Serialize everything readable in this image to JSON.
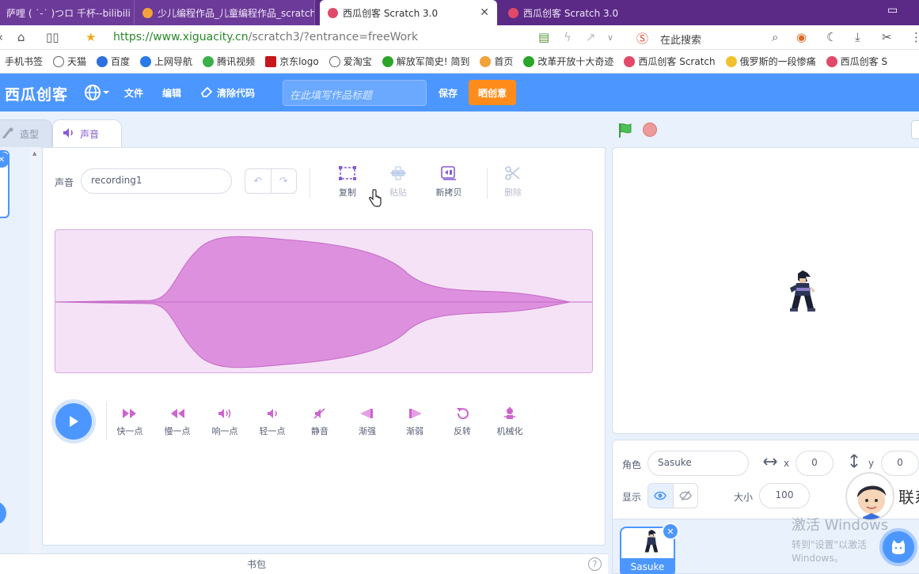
{
  "browser": {
    "tabs": [
      {
        "label": "萨哩 ( ˙-˙ )つロ 千杯--bilibili",
        "active": false
      },
      {
        "label": "少儿编程作品_儿童编程作品_scratch",
        "active": false
      },
      {
        "label": "西瓜创客 Scratch 3.0",
        "active": true
      },
      {
        "label": "西瓜创客 Scratch 3.0",
        "active": false
      }
    ],
    "url_scheme": "https://",
    "url_host": "www.xiguacity.cn",
    "url_path": "/scratch3/?entrance=freeWork",
    "search_placeholder": "在此搜索",
    "bookmarks": [
      "手机书签",
      "天猫",
      "百度",
      "上网导航",
      "腾讯视频",
      "京东logo",
      "爱淘宝",
      "解放军简史! 简到",
      "首页",
      "改革开放十大奇迹",
      "西瓜创客 Scratch",
      "俄罗斯的一段惨痛",
      "西瓜创客 S"
    ]
  },
  "menubar": {
    "logo": "西瓜创客",
    "file": "文件",
    "edit": "编辑",
    "clean": "清除代码",
    "title_placeholder": "在此填写作品标题",
    "save": "保存",
    "share": "晒创意"
  },
  "editor_tabs": {
    "costume": "造型",
    "sound": "声音"
  },
  "sound_editor": {
    "sound_label": "声音",
    "sound_name": "recording1",
    "tools": [
      {
        "label": "复制",
        "icon": "copy-icon",
        "enabled": true
      },
      {
        "label": "粘贴",
        "icon": "paste-icon",
        "enabled": false
      },
      {
        "label": "新拷贝",
        "icon": "copy-to-new-icon",
        "enabled": true
      },
      {
        "label": "删除",
        "icon": "delete-icon",
        "enabled": false
      }
    ],
    "effects": [
      "快一点",
      "慢一点",
      "响一点",
      "轻一点",
      "静音",
      "渐强",
      "渐弱",
      "反转",
      "机械化"
    ]
  },
  "backpack": {
    "label": "书包",
    "help": "?"
  },
  "sprite_info": {
    "sprite_label": "角色",
    "sprite_name": "Sasuke",
    "x_label": "x",
    "x_value": "0",
    "y_label": "y",
    "y_value": "0",
    "show_label": "显示",
    "size_label": "大小",
    "size_value": "100"
  },
  "sprites": [
    {
      "name": "Sasuke",
      "selected": true
    }
  ],
  "overlays": {
    "watermark_line1": "激活 Windows",
    "watermark_line2": "转到\"设置\"以激活 Windows。",
    "contact_text": "联系"
  },
  "colors": {
    "scratch_blue": "#4c97ff",
    "share_orange": "#ff8c1a",
    "sound_purple": "#cf63cf",
    "wave_fill": "#dd90de"
  }
}
